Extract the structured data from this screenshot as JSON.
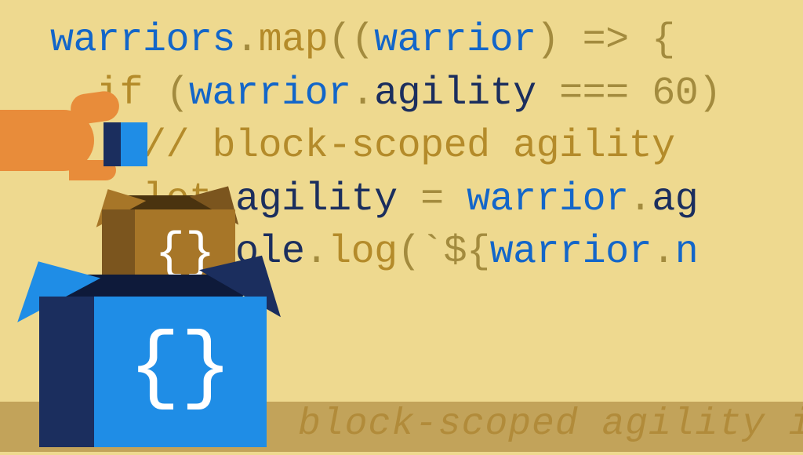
{
  "code": {
    "l1_obj": "warriors",
    "l1_dot": ".",
    "l1_method": "map",
    "l1_p1": "((",
    "l1_param": "warrior",
    "l1_p2": ") => {",
    "l2_kw": "if",
    "l2_p1": " (",
    "l2_var": "warrior",
    "l2_dot": ".",
    "l2_prop": "agility",
    "l2_eq": " === ",
    "l2_num": "60",
    "l2_p2": ")",
    "l3_comment": "// block-scoped agility",
    "l4_kw": "let",
    "l4_sp": " ",
    "l4_ident": "agility",
    "l4_eq": " = ",
    "l4_var": "warrior",
    "l4_dot": ".",
    "l4_tail": "ag",
    "l5_obj": "console",
    "l5_dot": ".",
    "l5_method": "log",
    "l5_p1": "(`${",
    "l5_var": "warrior",
    "l5_dot2": ".",
    "l5_tail": "n"
  },
  "floor_text": "block-scoped agility i",
  "braces": {
    "big": "{}",
    "small": "{}"
  }
}
